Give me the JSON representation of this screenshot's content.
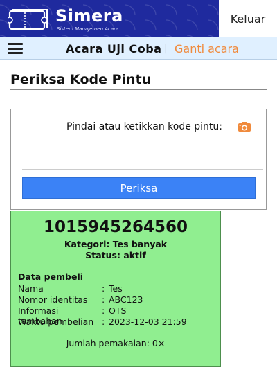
{
  "header": {
    "brand_name": "Simera",
    "brand_subtitle": "Sistem Manajemen Acara",
    "logout_label": "Keluar",
    "brand_color": "#1f2a9e"
  },
  "navbar": {
    "menu_icon": "hamburger-menu-icon",
    "event_title": "Acara Uji Coba",
    "separator": "|",
    "change_event_label": "Ganti acara",
    "background_color": "#e0f0ff",
    "accent_color": "#f08a3c"
  },
  "page": {
    "title": "Periksa Kode Pintu"
  },
  "scan": {
    "label": "Pindai atau ketikkan kode pintu:",
    "camera_icon": "camera-icon",
    "input_value": "",
    "check_button_label": "Periksa",
    "button_color": "#3b82f6"
  },
  "result": {
    "code": "1015945264560",
    "category": "Kategori: Tes banyak",
    "status": "Status: aktif",
    "buyer_heading": "Data pembeli",
    "fields": [
      {
        "key": "Nama",
        "sep": ":",
        "value": "Tes"
      },
      {
        "key": "Nomor identitas",
        "sep": ":",
        "value": "ABC123"
      },
      {
        "key": "Informasi tambahan",
        "sep": ":",
        "value": "OTS"
      },
      {
        "key": "Waktu pembelian",
        "sep": ":",
        "value": "2023-12-03 21:59"
      }
    ],
    "usage": "Jumlah pemakaian: 0×",
    "card_color": "#90ee90"
  }
}
